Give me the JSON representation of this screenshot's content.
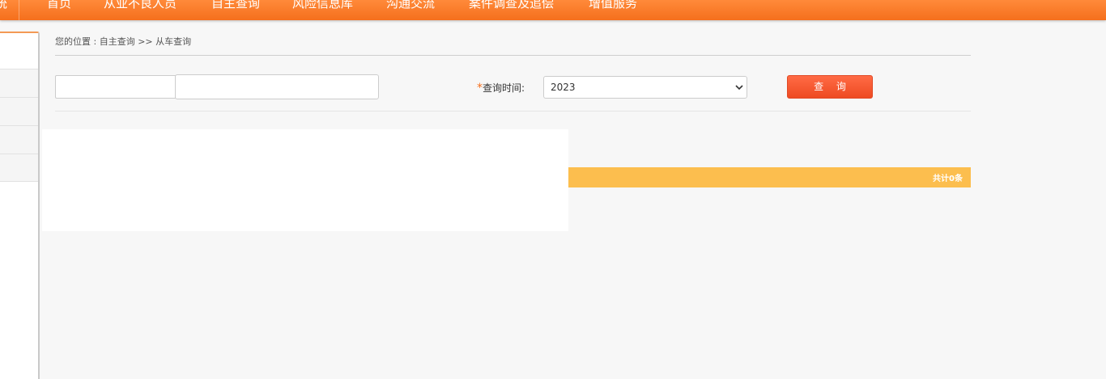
{
  "header": {
    "brand_fragment": "统",
    "nav": [
      {
        "label": "首页"
      },
      {
        "label": "从业不良人员"
      },
      {
        "label": "自主查询"
      },
      {
        "label": "风险信息库"
      },
      {
        "label": "沟通交流"
      },
      {
        "label": "案件调查及追偿"
      },
      {
        "label": "增值服务"
      }
    ]
  },
  "breadcrumb": {
    "prefix": "您的位置 : ",
    "path": "自主查询 >> 从车查询"
  },
  "form": {
    "input_a_value": "",
    "input_b_value": "",
    "required_mark": "*",
    "time_label": "查询时间:",
    "year_selected": "2023",
    "query_button": "查 询"
  },
  "results": {
    "total_text": "共计0条"
  },
  "colors": {
    "header_orange": "#f56f1c",
    "button_red": "#ee4a22",
    "result_bar_yellow": "#fcbe4e"
  }
}
